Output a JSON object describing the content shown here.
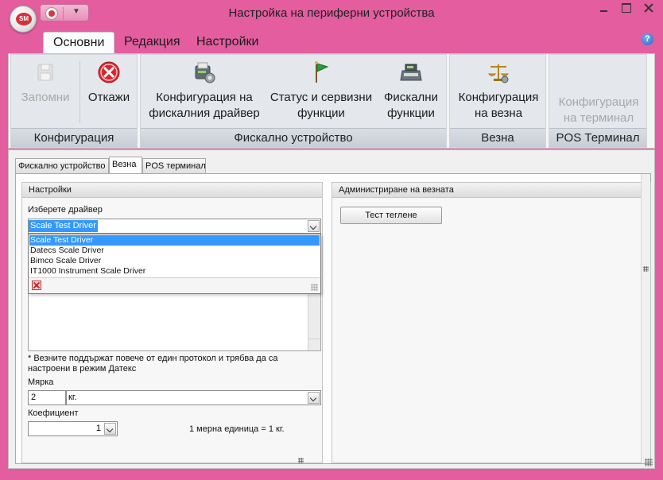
{
  "window": {
    "title": "Настройка на периферни устройства",
    "logo_text": "SM"
  },
  "ribbon_tabs": [
    {
      "label": "Основни",
      "active": true
    },
    {
      "label": "Редакция",
      "active": false
    },
    {
      "label": "Настройки",
      "active": false
    }
  ],
  "help_icon_text": "?",
  "ribbon": {
    "config_group": {
      "label": "Конфигурация",
      "save_label": "Запомни",
      "cancel_label": "Откажи"
    },
    "fiscal_group": {
      "label": "Фискално устройство",
      "driver_config_label": "Конфигурация на фискалния драйвер",
      "status_label": "Статус и сервизни функции",
      "fiscal_functions_label": "Фискални функции"
    },
    "scale_group": {
      "label": "Везна",
      "scale_config_label": "Конфигурация на везна"
    },
    "pos_group": {
      "label": "POS Терминал",
      "terminal_config_label": "Конфигурация на терминал"
    }
  },
  "doc_tabs": [
    {
      "label": "Фискално устройство",
      "active": false
    },
    {
      "label": "Везна",
      "active": true
    },
    {
      "label": "POS терминал",
      "active": false
    }
  ],
  "settings_panel": {
    "title": "Настройки",
    "driver_label": "Изберете драйвер",
    "driver_value": "Scale Test Driver",
    "driver_options": [
      "Scale Test Driver",
      "Datecs Scale Driver",
      "Bimco Scale Driver",
      "IT1000 Instrument Scale Driver"
    ],
    "note": "* Везните поддържат повече от един протокол и трябва да са настроени в режим Датекс",
    "measure_label": "Мярка",
    "measure_code": "2",
    "measure_unit": "кг.",
    "coefficient_label": "Коефициент",
    "coefficient_value": "1",
    "unit_note": "1 мерна единица = 1 кг."
  },
  "admin_panel": {
    "title": "Администриране на везната",
    "test_button_label": "Тест теглене"
  },
  "colors": {
    "window_chrome": "#e35d9f",
    "selection": "#3399ff"
  }
}
